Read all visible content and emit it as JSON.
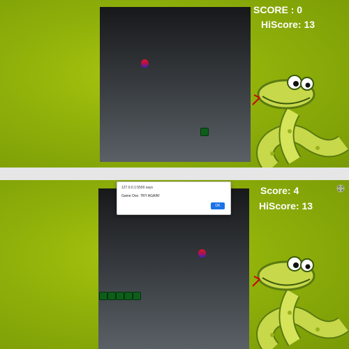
{
  "top": {
    "score_text": "SCORE : 0",
    "hiscore_text": "HiScore: 13"
  },
  "bottom": {
    "score_text": "Score: 4",
    "hiscore_text": "HiScore: 13"
  },
  "alert": {
    "origin": "127.0.0.1:5500 says",
    "message": "Game Ove. TRY AGAIN!",
    "ok_label": "OK"
  },
  "colors": {
    "background": "#8fb00a",
    "board_top": "#17181a",
    "board_bottom": "#5a6066",
    "snake": "#0c5e1a",
    "food_top": "#e0152a",
    "food_bottom": "#3a1fd0",
    "ok_button": "#1a73e8"
  },
  "icons": {
    "mascot": "cartoon-snake",
    "corner": "expand-icon"
  }
}
